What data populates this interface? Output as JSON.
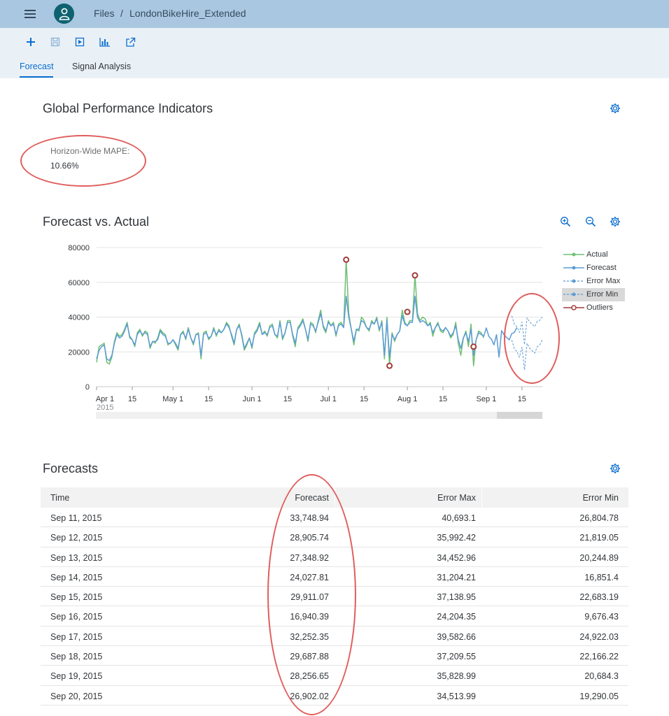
{
  "shell": {
    "breadcrumb_root": "Files",
    "breadcrumb_sep": "/",
    "breadcrumb_current": "LondonBikeHire_Extended"
  },
  "toolbar": {
    "icons": [
      "plus-icon",
      "save-icon",
      "run-icon",
      "chart-icon",
      "export-icon"
    ]
  },
  "tabs": [
    {
      "label": "Forecast",
      "active": true
    },
    {
      "label": "Signal Analysis",
      "active": false
    }
  ],
  "kpi": {
    "title": "Global Performance Indicators",
    "label": "Horizon-Wide MAPE:",
    "value": "10.66%"
  },
  "chart_section": {
    "title": "Forecast vs. Actual"
  },
  "chart_data": {
    "type": "line",
    "title": "",
    "xlabel": "",
    "ylabel": "",
    "ylim": [
      0,
      80000
    ],
    "yticks": [
      "0",
      "20000",
      "40000",
      "60000",
      "80000"
    ],
    "xticks": [
      "Apr 1",
      "15",
      "May 1",
      "15",
      "Jun 1",
      "15",
      "Jul 1",
      "15",
      "Aug 1",
      "15",
      "Sep 1",
      "15"
    ],
    "xtick_days": [
      0,
      14,
      30,
      44,
      61,
      75,
      91,
      105,
      122,
      136,
      153,
      167
    ],
    "year_label": "2015",
    "grid": true,
    "legend_position": "right",
    "colors": {
      "actual": "#6fbf73",
      "forecast": "#5b9bd5",
      "error_max": "#5b9bd5",
      "error_min": "#5b9bd5",
      "outliers": "#a33a3a"
    },
    "series": [
      {
        "name": "Actual",
        "start_day": 0,
        "values": [
          14000,
          23000,
          24000,
          25000,
          14000,
          13000,
          17000,
          26000,
          31000,
          29000,
          30000,
          33000,
          37000,
          28000,
          27000,
          23000,
          31000,
          33000,
          29000,
          32000,
          31000,
          22000,
          26000,
          25000,
          28000,
          33000,
          31000,
          30000,
          24000,
          25000,
          27000,
          24000,
          21000,
          30000,
          32000,
          27000,
          34000,
          28000,
          24000,
          30000,
          31000,
          16000,
          31000,
          32000,
          27000,
          29000,
          34000,
          29000,
          33000,
          31000,
          33000,
          37000,
          35000,
          29000,
          24000,
          33000,
          36000,
          29000,
          21000,
          24000,
          28000,
          22000,
          31000,
          33000,
          37000,
          30000,
          32000,
          29000,
          35000,
          36000,
          30000,
          28000,
          38000,
          27000,
          31000,
          38000,
          38000,
          29000,
          23000,
          34000,
          36000,
          39000,
          33000,
          26000,
          37000,
          36000,
          31000,
          38000,
          44000,
          34000,
          31000,
          38000,
          35000,
          37000,
          29000,
          36000,
          37000,
          34000,
          73000,
          42000,
          33000,
          24000,
          33000,
          32000,
          40000,
          38000,
          34000,
          32000,
          38000,
          36000,
          40000,
          32000,
          38000,
          16000,
          40000,
          12000,
          31000,
          26000,
          30000,
          32000,
          44000,
          37000,
          35000,
          38000,
          38000,
          64000,
          42000,
          38000,
          40000,
          39000,
          35000,
          37000,
          29000,
          34000,
          37000,
          32000,
          31000,
          34000,
          32000,
          28000,
          30000,
          37000,
          25000,
          18000,
          28000,
          32000,
          23000,
          36000,
          12000,
          27000,
          32000,
          31000,
          28000
        ]
      },
      {
        "name": "Forecast",
        "start_day": 0,
        "values": [
          16000,
          21000,
          23000,
          24000,
          16000,
          15000,
          18000,
          25000,
          30000,
          28000,
          29000,
          32000,
          36000,
          29000,
          27000,
          24000,
          30000,
          32000,
          30000,
          31000,
          30000,
          23000,
          26000,
          26000,
          27000,
          32000,
          30000,
          29000,
          25000,
          25000,
          27000,
          25000,
          22000,
          30000,
          31000,
          28000,
          33000,
          28000,
          25000,
          30000,
          30000,
          18000,
          30000,
          31000,
          28000,
          29000,
          33000,
          30000,
          32000,
          31000,
          33000,
          36000,
          34000,
          30000,
          25000,
          33000,
          35000,
          30000,
          22000,
          25000,
          28000,
          23000,
          30000,
          32000,
          36000,
          30000,
          31000,
          30000,
          34000,
          35000,
          30000,
          29000,
          37000,
          28000,
          31000,
          37000,
          37000,
          30000,
          25000,
          33000,
          35000,
          38000,
          33000,
          27000,
          36000,
          35000,
          32000,
          37000,
          42000,
          35000,
          32000,
          37000,
          35000,
          36000,
          30000,
          35000,
          36000,
          34000,
          52000,
          40000,
          33000,
          26000,
          33000,
          33000,
          38000,
          37000,
          34000,
          33000,
          37000,
          36000,
          39000,
          33000,
          37000,
          18000,
          38000,
          17000,
          30000,
          27000,
          30000,
          32000,
          41000,
          36000,
          35000,
          37000,
          37000,
          52000,
          40000,
          37000,
          38000,
          37000,
          35000,
          36000,
          31000,
          34000,
          36000,
          33000,
          32000,
          34000,
          32000,
          29000,
          31000,
          35000,
          27000,
          22000,
          28000,
          31000,
          26000,
          33000,
          18000,
          27000,
          31000,
          30000,
          29000,
          33749,
          28906,
          27349,
          24028,
          29911,
          16940,
          32252,
          29688,
          28257,
          26902,
          30500,
          31200,
          34000
        ]
      },
      {
        "name": "Error Max",
        "start_day": 163,
        "values": [
          40693,
          35992,
          34453,
          31204,
          37139,
          24204,
          39583,
          37210,
          35829,
          34514,
          37500,
          38200,
          40000
        ]
      },
      {
        "name": "Error Min",
        "start_day": 163,
        "values": [
          26805,
          21819,
          20245,
          16851,
          22683,
          9676,
          24922,
          22166,
          20684,
          19290,
          23000,
          24000,
          27000
        ]
      },
      {
        "name": "Outliers",
        "type": "scatter",
        "x_day": [
          98,
          115,
          122,
          125,
          148
        ],
        "values": [
          73000,
          12000,
          43000,
          64000,
          23000
        ]
      }
    ],
    "visible_days": [
      0,
      175
    ]
  },
  "forecasts": {
    "title": "Forecasts",
    "columns": [
      "Time",
      "Forecast",
      "Error Max",
      "Error Min"
    ],
    "rows": [
      [
        "Sep 11, 2015",
        "33,748.94",
        "40,693.1",
        "26,804.78"
      ],
      [
        "Sep 12, 2015",
        "28,905.74",
        "35,992.42",
        "21,819.05"
      ],
      [
        "Sep 13, 2015",
        "27,348.92",
        "34,452.96",
        "20,244.89"
      ],
      [
        "Sep 14, 2015",
        "24,027.81",
        "31,204.21",
        "16,851.4"
      ],
      [
        "Sep 15, 2015",
        "29,911.07",
        "37,138.95",
        "22,683.19"
      ],
      [
        "Sep 16, 2015",
        "16,940.39",
        "24,204.35",
        "9,676.43"
      ],
      [
        "Sep 17, 2015",
        "32,252.35",
        "39,582.66",
        "24,922.03"
      ],
      [
        "Sep 18, 2015",
        "29,687.88",
        "37,209.55",
        "22,166.22"
      ],
      [
        "Sep 19, 2015",
        "28,256.65",
        "35,828.99",
        "20,684.3"
      ],
      [
        "Sep 20, 2015",
        "26,902.02",
        "34,513.99",
        "19,290.05"
      ]
    ]
  }
}
